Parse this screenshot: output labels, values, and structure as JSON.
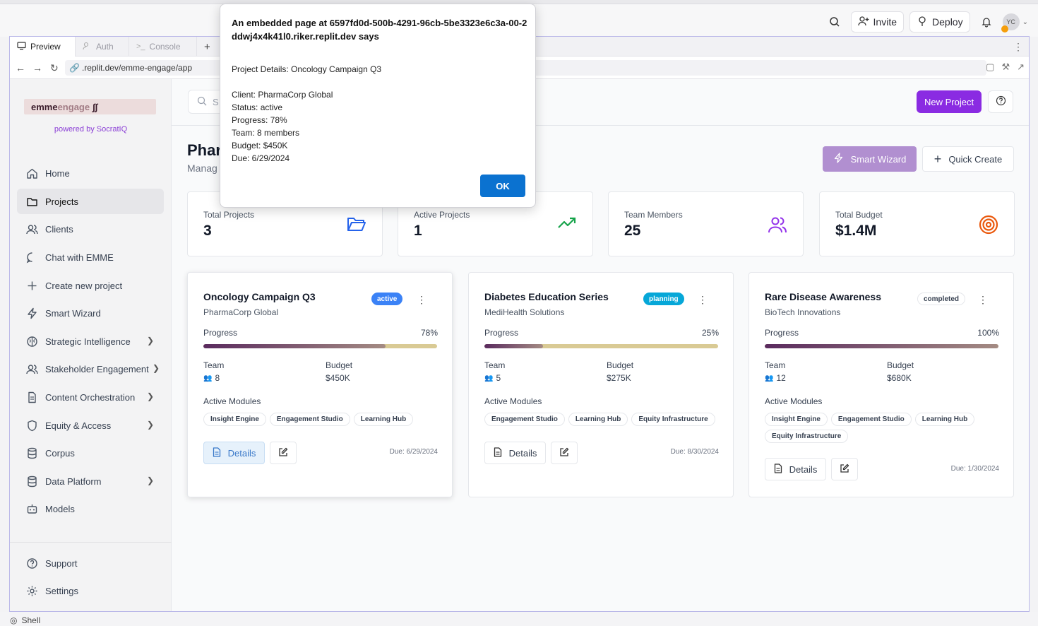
{
  "replit": {
    "invite_label": "Invite",
    "deploy_label": "Deploy",
    "avatar_initials": "YC",
    "tabs": [
      {
        "label": "Preview"
      },
      {
        "label": "Auth"
      },
      {
        "label": "Console"
      }
    ],
    "url": ".replit.dev/emme-engage/app",
    "shell_label": "Shell"
  },
  "sidebar": {
    "logo_text_1": "emme",
    "logo_text_2": "engage",
    "powered_by": "powered by SocratIQ",
    "items": [
      {
        "label": "Home",
        "icon": "home-icon"
      },
      {
        "label": "Projects",
        "icon": "folder-icon"
      },
      {
        "label": "Clients",
        "icon": "users-icon"
      },
      {
        "label": "Chat with EMME",
        "icon": "chat-icon"
      },
      {
        "label": "Create new project",
        "icon": "plus-icon"
      },
      {
        "label": "Smart Wizard",
        "icon": "bolt-icon"
      },
      {
        "label": "Strategic Intelligence",
        "icon": "brain-icon"
      },
      {
        "label": "Stakeholder Engagement",
        "icon": "users-icon"
      },
      {
        "label": "Content Orchestration",
        "icon": "document-icon"
      },
      {
        "label": "Equity & Access",
        "icon": "shield-icon"
      },
      {
        "label": "Corpus",
        "icon": "database-icon"
      },
      {
        "label": "Data Platform",
        "icon": "database-icon"
      },
      {
        "label": "Models",
        "icon": "robot-icon"
      }
    ],
    "footer": [
      {
        "label": "Support",
        "icon": "help-circle-icon"
      },
      {
        "label": "Settings",
        "icon": "gear-icon"
      }
    ]
  },
  "header": {
    "search_placeholder": "S",
    "new_project_label": "New Project"
  },
  "page": {
    "title": "Phar",
    "subtitle": "Manag",
    "smart_wizard_label": "Smart Wizard",
    "quick_create_label": "Quick Create"
  },
  "stats": [
    {
      "label": "Total Projects",
      "value": "3",
      "icon": "folder-open-icon",
      "color": "#2563eb"
    },
    {
      "label": "Active Projects",
      "value": "1",
      "icon": "trending-up-icon",
      "color": "#16a34a"
    },
    {
      "label": "Team Members",
      "value": "25",
      "icon": "users-icon",
      "color": "#9333ea"
    },
    {
      "label": "Total Budget",
      "value": "$1.4M",
      "icon": "target-icon",
      "color": "#ea580c"
    }
  ],
  "projects": [
    {
      "title": "Oncology Campaign Q3",
      "client": "PharmaCorp Global",
      "status": "active",
      "progress_label": "Progress",
      "progress_text": "78%",
      "progress": 78,
      "team_label": "Team",
      "team": "8",
      "budget_label": "Budget",
      "budget": "$450K",
      "modules_label": "Active Modules",
      "modules": [
        "Insight Engine",
        "Engagement Studio",
        "Learning Hub"
      ],
      "details_label": "Details",
      "due": "Due: 6/29/2024"
    },
    {
      "title": "Diabetes Education Series",
      "client": "MediHealth Solutions",
      "status": "planning",
      "progress_label": "Progress",
      "progress_text": "25%",
      "progress": 25,
      "team_label": "Team",
      "team": "5",
      "budget_label": "Budget",
      "budget": "$275K",
      "modules_label": "Active Modules",
      "modules": [
        "Engagement Studio",
        "Learning Hub",
        "Equity Infrastructure"
      ],
      "details_label": "Details",
      "due": "Due: 8/30/2024"
    },
    {
      "title": "Rare Disease Awareness",
      "client": "BioTech Innovations",
      "status": "completed",
      "progress_label": "Progress",
      "progress_text": "100%",
      "progress": 100,
      "team_label": "Team",
      "team": "12",
      "budget_label": "Budget",
      "budget": "$680K",
      "modules_label": "Active Modules",
      "modules": [
        "Insight Engine",
        "Engagement Studio",
        "Learning Hub",
        "Equity Infrastructure"
      ],
      "details_label": "Details",
      "due": "Due: 1/30/2024"
    }
  ],
  "alert": {
    "heading": "An embedded page at 6597fd0d-500b-4291-96cb-5be3323e6c3a-00-2ddwj4x4k41l0.riker.replit.dev says",
    "line1": "Project Details: Oncology Campaign Q3",
    "line2": "Client: PharmaCorp Global",
    "line3": "Status: active",
    "line4": "Progress: 78%",
    "line5": "Team: 8 members",
    "line6": "Budget: $450K",
    "line7": "Due: 6/29/2024",
    "ok_label": "OK"
  },
  "colors": {
    "accent": "#8a2be2",
    "active_badge": "#3b82f6",
    "planning_badge": "#06a7d8",
    "ok_button": "#0b72d0"
  }
}
